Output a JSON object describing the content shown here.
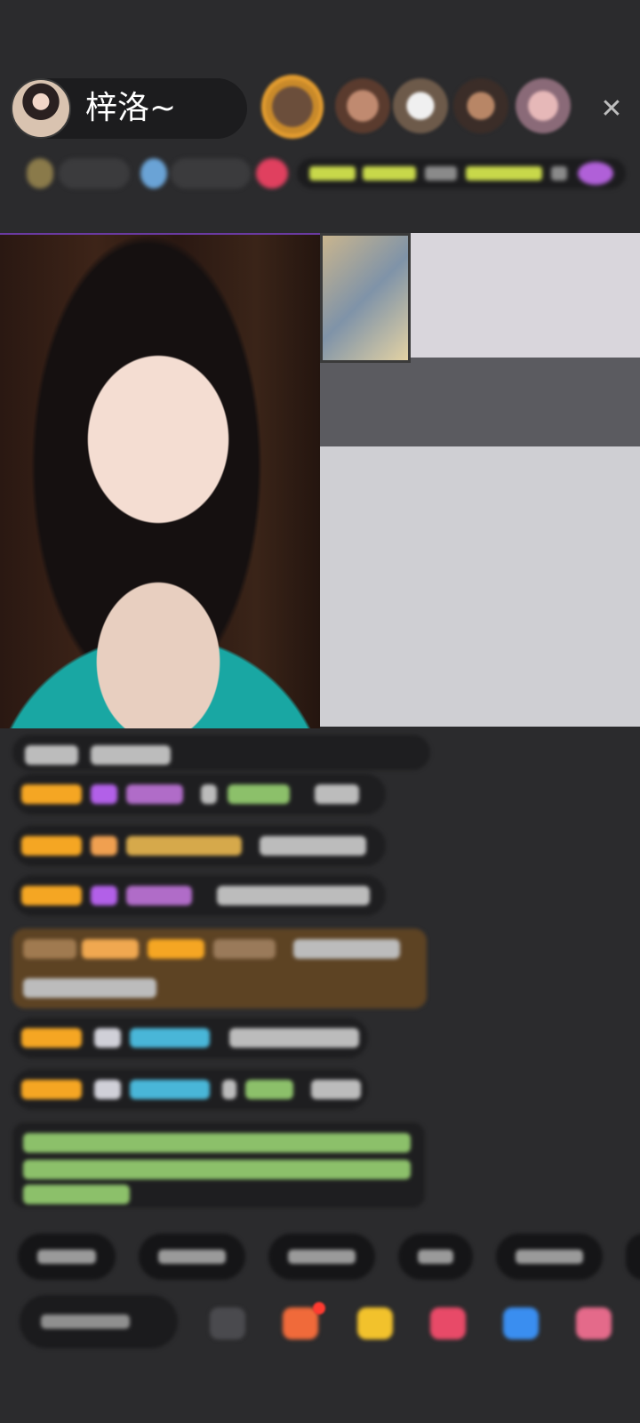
{
  "host": {
    "name": "梓洛~"
  },
  "icons": {
    "close": "close-icon",
    "emoji": "emoji-icon",
    "gifts": [
      "gift-box-icon",
      "treasure-icon",
      "heart-gift-icon",
      "game-icon",
      "more-gift-icon"
    ]
  },
  "colors": {
    "background": "#2b2b2d",
    "badge": "#f5a623",
    "highlight": "#7a5020"
  }
}
